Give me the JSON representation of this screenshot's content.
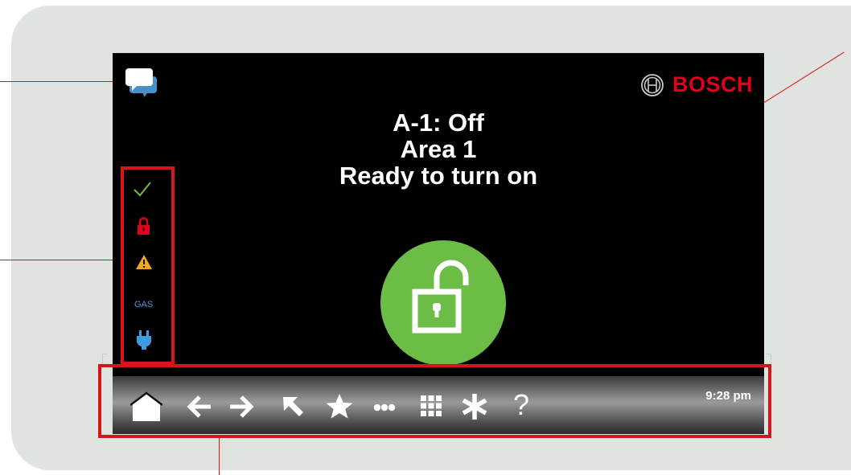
{
  "brand": {
    "name": "BOSCH"
  },
  "status": {
    "line1": "A-1: Off",
    "line2": "Area 1",
    "line3": "Ready to turn on"
  },
  "side_icons": {
    "gas_label": "GAS"
  },
  "bottom_bar": {
    "clock": "9:28 pm",
    "buttons": [
      "home-icon",
      "back-arrow-icon",
      "forward-arrow-icon",
      "top-left-arrow-icon",
      "star-icon",
      "more-icon",
      "keypad-icon",
      "asterisk-icon",
      "help-icon"
    ],
    "help_label": "?"
  },
  "main_button": {
    "icon": "unlocked-padlock-icon",
    "color": "#6cbd45"
  },
  "colors": {
    "accent_red": "#e2001a",
    "callout_red": "#d7141a",
    "ready_green": "#6cbd45",
    "info_blue": "#3d9be0",
    "warning_amber": "#f5a623"
  }
}
